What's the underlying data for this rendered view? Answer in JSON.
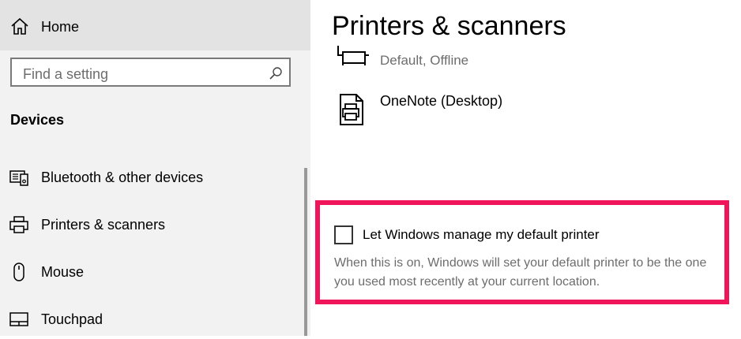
{
  "sidebar": {
    "home_label": "Home",
    "search": {
      "placeholder": "Find a setting"
    },
    "section_title": "Devices",
    "items": [
      {
        "label": "Bluetooth & other devices",
        "icon": "bluetooth-devices-icon"
      },
      {
        "label": "Printers & scanners",
        "icon": "printer-icon"
      },
      {
        "label": "Mouse",
        "icon": "mouse-icon"
      },
      {
        "label": "Touchpad",
        "icon": "touchpad-icon"
      }
    ]
  },
  "main": {
    "title": "Printers & scanners",
    "printers": [
      {
        "name": "",
        "status": "Default, Offline",
        "icon": "printer-icon"
      },
      {
        "name": "OneNote (Desktop)",
        "status": "",
        "icon": "document-printer-icon"
      }
    ],
    "default_printer_option": {
      "label": "Let Windows manage my default printer",
      "checked": false,
      "description": "When this is on, Windows will set your default printer to be the one you used most recently at your current location."
    }
  },
  "colors": {
    "sidebar_bg": "#f2f2f2",
    "home_bg": "#e3e3e3",
    "highlight": "#f0145a",
    "secondary_text": "#6d6d6d"
  }
}
